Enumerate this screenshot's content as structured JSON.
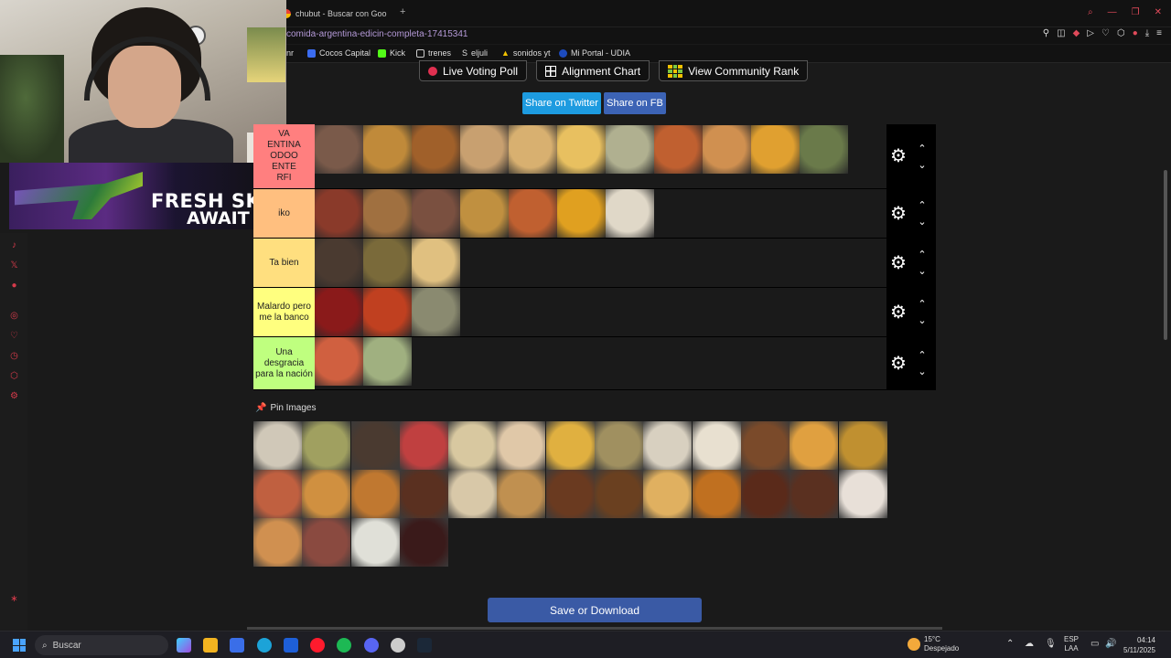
{
  "browser": {
    "tab_title": "chubut - Buscar con Goo",
    "new_tab": "+",
    "url": "comida-argentina-edicin-completa-17415341",
    "bookmarks": [
      {
        "label": "nr",
        "color": "#888"
      },
      {
        "label": "Cocos Capital",
        "color": "#3b6cf0"
      },
      {
        "label": "Kick",
        "color": "#53fc18"
      },
      {
        "label": "trenes",
        "color": "#cccccc"
      },
      {
        "label": "eljuli",
        "color": "#ffffff"
      },
      {
        "label": "sonidos yt",
        "color": "#f2c200"
      },
      {
        "label": "Mi Portal - UDIA",
        "color": "#1d4bbd"
      }
    ]
  },
  "overlay": {
    "promo_line1": "FRESH SKI",
    "promo_line2": "AWAIT"
  },
  "page": {
    "buttons": [
      {
        "label": "Live Voting Poll",
        "icon": "red-dot-icon"
      },
      {
        "label": "Alignment Chart",
        "icon": "alignment-chart-icon"
      },
      {
        "label": "View Community Rank",
        "icon": "community-grid-icon"
      }
    ],
    "share_twitter": "Share on Twitter",
    "share_fb": "Share on FB",
    "tiers": [
      {
        "label": "VA\nENTINA\nODOO\nENTE\nRFI",
        "color": "#ff7f7f",
        "items": [
          "#7a5a4a",
          "#c08a3a",
          "#a0602a",
          "#c8a070",
          "#d8b070",
          "#e8c060",
          "#b0b090",
          "#c06030",
          "#d09050",
          "#e0a030",
          "#6a7a4a"
        ]
      },
      {
        "label": "iko",
        "color": "#ffbf7f",
        "items": [
          "#8a3a2a",
          "#a07040",
          "#7a5040",
          "#c09040",
          "#c06030",
          "#e0a020",
          "#e0d8c8"
        ]
      },
      {
        "label": "Ta bien",
        "color": "#ffdf7f",
        "items": [
          "#4a3a30",
          "#7a6a3a",
          "#e0c080"
        ]
      },
      {
        "label": "Malardo pero me la banco",
        "color": "#ffff7f",
        "items": [
          "#8a1a1a",
          "#c04020",
          "#8a8a70"
        ]
      },
      {
        "label": "Una desgracia para la nación",
        "color": "#bfff7f",
        "items": [
          "#d06040",
          "#a0b080"
        ]
      }
    ],
    "tier_controls": {
      "gear": "⚙",
      "up": "⌃",
      "down": "⌄"
    },
    "pin_title": "Pin Images",
    "pin_items": [
      "#d0c8b8",
      "#a0a060",
      "#4a3a30",
      "#c04040",
      "#d8c8a0",
      "#e0c8a8",
      "#e0b040",
      "#a09060",
      "#d8d0c0",
      "#e8e0d0",
      "#7a4a2a",
      "#e0a040",
      "#c09030",
      "#c06040",
      "#d09040",
      "#c07830",
      "#5a3020",
      "#d8c8a8",
      "#c09050",
      "#6a3a20",
      "#6a4020",
      "#e0b060",
      "#c07020",
      "#5a2a1a",
      "#5a3020",
      "#e8e0d8",
      "#d09050",
      "#8a4a40",
      "#e0e0d8",
      "#3a1a1a"
    ],
    "save_label": "Save or Download"
  },
  "taskbar": {
    "search_placeholder": "Buscar",
    "weather_temp": "15°C",
    "weather_desc": "Despejado",
    "lang_1": "ESP",
    "lang_2": "LAA",
    "time": "04:14",
    "date": "5/11/2025"
  }
}
